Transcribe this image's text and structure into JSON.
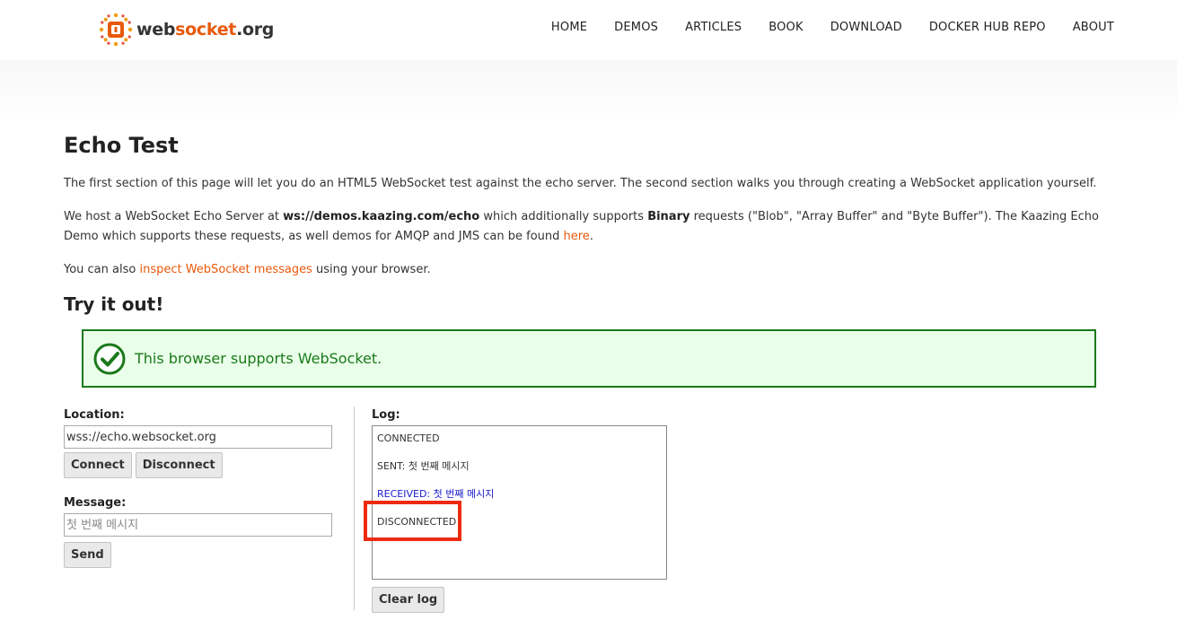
{
  "header": {
    "logo": {
      "part1": "web",
      "part2": "socket",
      "part3": ".org"
    },
    "nav": [
      "HOME",
      "DEMOS",
      "ARTICLES",
      "BOOK",
      "DOWNLOAD",
      "DOCKER HUB REPO",
      "ABOUT"
    ]
  },
  "page": {
    "title": "Echo Test",
    "intro": "The first section of this page will let you do an HTML5 WebSocket test against the echo server. The second section walks you through creating a WebSocket application yourself.",
    "host": {
      "t1": "We host a WebSocket Echo Server at ",
      "server": "ws://demos.kaazing.com/echo",
      "t2": " which additionally supports ",
      "binary": "Binary",
      "t3": " requests (\"Blob\", \"Array Buffer\" and \"Byte Buffer\"). The Kaazing Echo Demo which supports these requests, as well demos for AMQP and JMS can be found ",
      "link": "here",
      "t4": "."
    },
    "inspect": {
      "t1": "You can also ",
      "link": "inspect WebSocket messages",
      "t2": " using your browser."
    },
    "try_heading": "Try it out!"
  },
  "support_banner": {
    "text": "This browser supports WebSocket.",
    "color": "#1a7a1a"
  },
  "form": {
    "location_label": "Location:",
    "location_value": "wss://echo.websocket.org",
    "connect_label": "Connect",
    "disconnect_label": "Disconnect",
    "message_label": "Message:",
    "message_placeholder": "첫 번째 메시지",
    "send_label": "Send"
  },
  "log": {
    "label": "Log:",
    "lines": [
      "CONNECTED",
      "SENT: 첫 번째 메시지",
      "RECEIVED: 첫 번째 메시지",
      "DISCONNECTED"
    ],
    "clear_label": "Clear log",
    "received_color": "#1a1acc",
    "highlight_color": "#ee2a0e"
  }
}
